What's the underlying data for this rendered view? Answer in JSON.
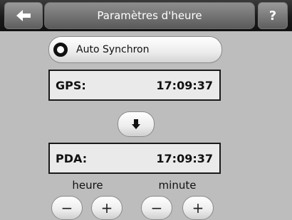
{
  "header": {
    "title": "Paramètres d'heure",
    "back_icon": "arrow-left-icon",
    "help_label": "?"
  },
  "sync": {
    "label": "Auto Synchron",
    "icon": "radio-ring-icon"
  },
  "gps": {
    "label": "GPS:",
    "time": "17:09:37"
  },
  "transfer": {
    "icon": "arrow-down-icon"
  },
  "pda": {
    "label": "PDA:",
    "time": "17:09:37"
  },
  "adjust": {
    "hour_label": "heure",
    "minute_label": "minute",
    "minus": "−",
    "plus": "+"
  }
}
